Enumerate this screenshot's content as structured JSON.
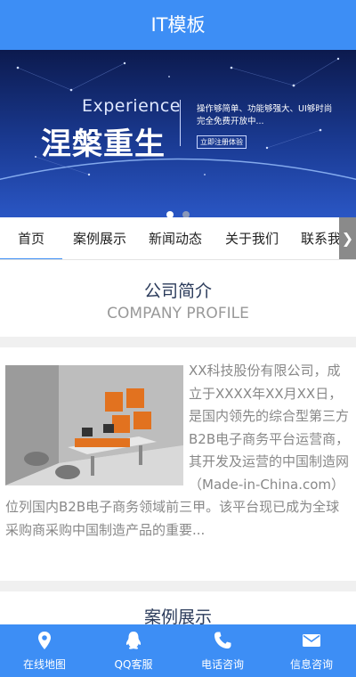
{
  "header": {
    "title": "IT模板"
  },
  "banner": {
    "subtitle": "Experience",
    "headline": "涅槃重生",
    "description": "操作够简单、功能够强大、UI够时尚完全免费开放中...",
    "button_label": "立即注册体验",
    "slide_count": 2,
    "active_slide": 1
  },
  "nav": {
    "items": [
      {
        "label": "首页",
        "active": true
      },
      {
        "label": "案例展示",
        "active": false
      },
      {
        "label": "新闻动态",
        "active": false
      },
      {
        "label": "关于我们",
        "active": false
      },
      {
        "label": "联系我们",
        "active": false
      }
    ],
    "scroll_arrow": "❯"
  },
  "company": {
    "title_cn": "公司简介",
    "title_en": "COMPANY PROFILE",
    "text": "XX科技股份有限公司，成立于XXXX年XX月XX日，是国内领先的综合型第三方B2B电子商务平台运营商，其开发及运营的中国制造网（Made-in-China.com）位列国内B2B电子商务领域前三甲。该平台现已成为全球采购商采购中国制造产品的重要..."
  },
  "cases": {
    "title_cn": "案例展示"
  },
  "bottom_bar": {
    "items": [
      {
        "label": "在线地图",
        "icon": "map-pin-icon"
      },
      {
        "label": "QQ客服",
        "icon": "qq-penguin-icon"
      },
      {
        "label": "电话咨询",
        "icon": "phone-icon"
      },
      {
        "label": "信息咨询",
        "icon": "mail-icon"
      }
    ]
  },
  "colors": {
    "primary": "#3d8ef5",
    "text_muted": "#888888",
    "title_dark": "#2a3a5a"
  }
}
